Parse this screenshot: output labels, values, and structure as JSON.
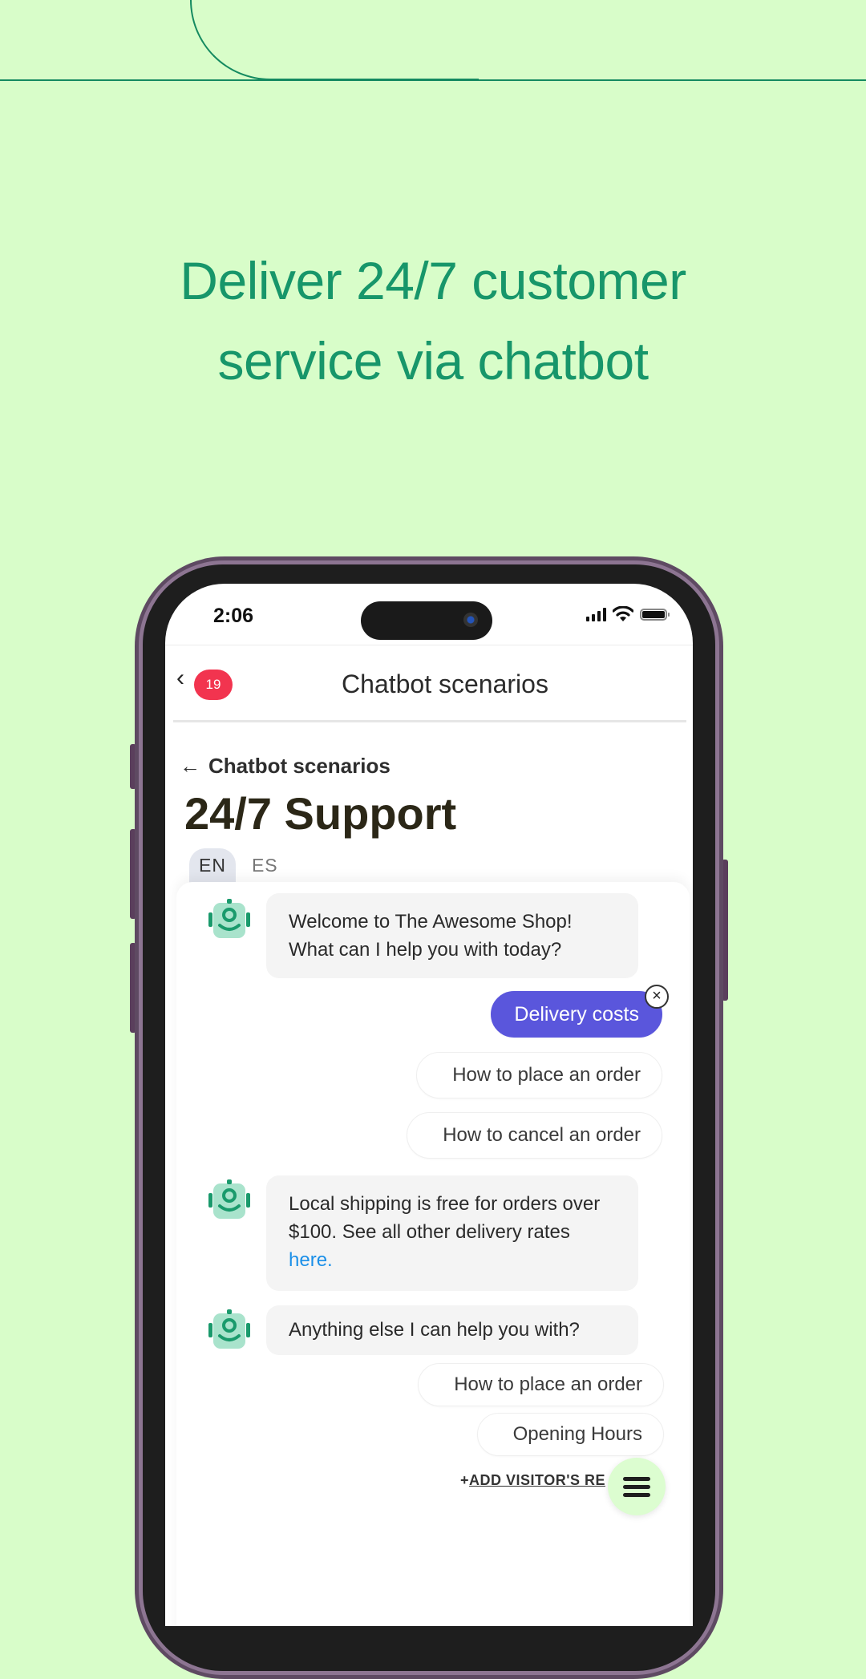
{
  "hero": {
    "headline_line1": "Deliver 24/7 customer",
    "headline_line2": "service via chatbot"
  },
  "colors": {
    "background": "#d8fdc9",
    "accent_green": "#17966a",
    "selected_chip": "#5a56dc",
    "badge_red": "#f2344f",
    "link_blue": "#1a8fe8"
  },
  "statusbar": {
    "time": "2:06",
    "icons": [
      "signal-icon",
      "wifi-icon",
      "battery-icon"
    ]
  },
  "navbar": {
    "back_icon": "chevron-left",
    "badge_count": "19",
    "title": "Chatbot scenarios"
  },
  "page": {
    "breadcrumb_icon": "←",
    "breadcrumb": "Chatbot scenarios",
    "title": "24/7 Support",
    "languages": [
      {
        "code": "EN",
        "active": true
      },
      {
        "code": "ES",
        "active": false
      }
    ]
  },
  "chat": {
    "messages": [
      {
        "type": "bot",
        "text_line1": "Welcome to The Awesome Shop!",
        "text_line2": "What can I help you with today?"
      },
      {
        "type": "chip_selected",
        "label": "Delivery costs",
        "close_icon": "×"
      },
      {
        "type": "chip",
        "label": "How to place an order"
      },
      {
        "type": "chip",
        "label": "How to cancel an order"
      },
      {
        "type": "bot",
        "text": "Local shipping is free for orders over $100. See all other delivery rates",
        "link": "here."
      },
      {
        "type": "bot",
        "text": "Anything else I can help you with?"
      },
      {
        "type": "chip",
        "label": "How to place an order"
      },
      {
        "type": "chip",
        "label": "Opening Hours"
      }
    ],
    "add_reply_icon": "+",
    "add_reply_label": "ADD VISITOR'S RE"
  }
}
